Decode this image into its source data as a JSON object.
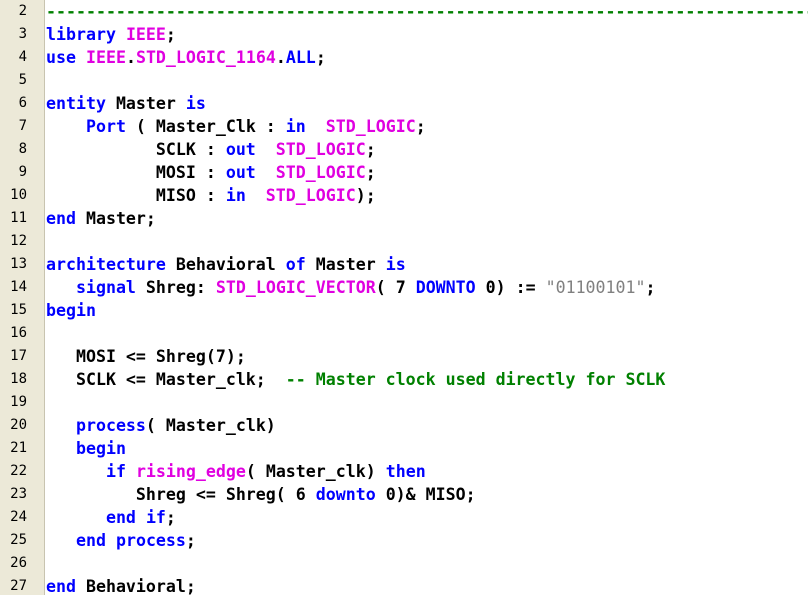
{
  "editor": {
    "colors": {
      "text": "#000000",
      "keyword": "#0000ff",
      "type": "#e000e0",
      "string": "#808080",
      "comment": "#008000",
      "gutter": "#ece9d8"
    },
    "lines": [
      {
        "number": "2",
        "tokens": [
          {
            "t": "comment",
            "v": "-----------------------------------------------------------------------------------"
          }
        ]
      },
      {
        "number": "3",
        "tokens": [
          {
            "t": "keyword",
            "v": "library"
          },
          {
            "t": "text",
            "v": " "
          },
          {
            "t": "type",
            "v": "IEEE"
          },
          {
            "t": "text",
            "v": ";"
          }
        ]
      },
      {
        "number": "4",
        "tokens": [
          {
            "t": "keyword",
            "v": "use"
          },
          {
            "t": "text",
            "v": " "
          },
          {
            "t": "type",
            "v": "IEEE"
          },
          {
            "t": "text",
            "v": "."
          },
          {
            "t": "type",
            "v": "STD_LOGIC_1164"
          },
          {
            "t": "text",
            "v": "."
          },
          {
            "t": "keyword",
            "v": "ALL"
          },
          {
            "t": "text",
            "v": ";"
          }
        ]
      },
      {
        "number": "5",
        "tokens": []
      },
      {
        "number": "6",
        "tokens": [
          {
            "t": "keyword",
            "v": "entity"
          },
          {
            "t": "text",
            "v": " Master "
          },
          {
            "t": "keyword",
            "v": "is"
          }
        ]
      },
      {
        "number": "7",
        "tokens": [
          {
            "t": "text",
            "v": "    "
          },
          {
            "t": "keyword",
            "v": "Port"
          },
          {
            "t": "text",
            "v": " ( Master_Clk : "
          },
          {
            "t": "keyword",
            "v": "in"
          },
          {
            "t": "text",
            "v": "  "
          },
          {
            "t": "type",
            "v": "STD_LOGIC"
          },
          {
            "t": "text",
            "v": ";"
          }
        ]
      },
      {
        "number": "8",
        "tokens": [
          {
            "t": "text",
            "v": "           SCLK : "
          },
          {
            "t": "keyword",
            "v": "out"
          },
          {
            "t": "text",
            "v": "  "
          },
          {
            "t": "type",
            "v": "STD_LOGIC"
          },
          {
            "t": "text",
            "v": ";"
          }
        ]
      },
      {
        "number": "9",
        "tokens": [
          {
            "t": "text",
            "v": "           MOSI : "
          },
          {
            "t": "keyword",
            "v": "out"
          },
          {
            "t": "text",
            "v": "  "
          },
          {
            "t": "type",
            "v": "STD_LOGIC"
          },
          {
            "t": "text",
            "v": ";"
          }
        ]
      },
      {
        "number": "10",
        "tokens": [
          {
            "t": "text",
            "v": "           MISO : "
          },
          {
            "t": "keyword",
            "v": "in"
          },
          {
            "t": "text",
            "v": "  "
          },
          {
            "t": "type",
            "v": "STD_LOGIC"
          },
          {
            "t": "text",
            "v": ");"
          }
        ]
      },
      {
        "number": "11",
        "tokens": [
          {
            "t": "keyword",
            "v": "end"
          },
          {
            "t": "text",
            "v": " Master;"
          }
        ]
      },
      {
        "number": "12",
        "tokens": []
      },
      {
        "number": "13",
        "tokens": [
          {
            "t": "keyword",
            "v": "architecture"
          },
          {
            "t": "text",
            "v": " Behavioral "
          },
          {
            "t": "keyword",
            "v": "of"
          },
          {
            "t": "text",
            "v": " Master "
          },
          {
            "t": "keyword",
            "v": "is"
          }
        ]
      },
      {
        "number": "14",
        "tokens": [
          {
            "t": "text",
            "v": "   "
          },
          {
            "t": "keyword",
            "v": "signal"
          },
          {
            "t": "text",
            "v": " Shreg: "
          },
          {
            "t": "type",
            "v": "STD_LOGIC_VECTOR"
          },
          {
            "t": "text",
            "v": "( 7 "
          },
          {
            "t": "keyword",
            "v": "DOWNTO"
          },
          {
            "t": "text",
            "v": " 0) := "
          },
          {
            "t": "string",
            "v": "\"01100101\""
          },
          {
            "t": "text",
            "v": ";"
          }
        ]
      },
      {
        "number": "15",
        "tokens": [
          {
            "t": "keyword",
            "v": "begin"
          }
        ]
      },
      {
        "number": "16",
        "tokens": []
      },
      {
        "number": "17",
        "tokens": [
          {
            "t": "text",
            "v": "   MOSI <= Shreg(7);"
          }
        ]
      },
      {
        "number": "18",
        "tokens": [
          {
            "t": "text",
            "v": "   SCLK <= Master_clk;  "
          },
          {
            "t": "comment",
            "v": "-- Master clock used directly for SCLK"
          }
        ]
      },
      {
        "number": "19",
        "tokens": []
      },
      {
        "number": "20",
        "tokens": [
          {
            "t": "text",
            "v": "   "
          },
          {
            "t": "keyword",
            "v": "process"
          },
          {
            "t": "text",
            "v": "( Master_clk)"
          }
        ]
      },
      {
        "number": "21",
        "tokens": [
          {
            "t": "text",
            "v": "   "
          },
          {
            "t": "keyword",
            "v": "begin"
          }
        ]
      },
      {
        "number": "22",
        "tokens": [
          {
            "t": "text",
            "v": "      "
          },
          {
            "t": "keyword",
            "v": "if"
          },
          {
            "t": "text",
            "v": " "
          },
          {
            "t": "type",
            "v": "rising_edge"
          },
          {
            "t": "text",
            "v": "( Master_clk) "
          },
          {
            "t": "keyword",
            "v": "then"
          }
        ]
      },
      {
        "number": "23",
        "tokens": [
          {
            "t": "text",
            "v": "         Shreg <= Shreg( 6 "
          },
          {
            "t": "keyword",
            "v": "downto"
          },
          {
            "t": "text",
            "v": " 0)& MISO;"
          }
        ]
      },
      {
        "number": "24",
        "tokens": [
          {
            "t": "text",
            "v": "      "
          },
          {
            "t": "keyword",
            "v": "end"
          },
          {
            "t": "text",
            "v": " "
          },
          {
            "t": "keyword",
            "v": "if"
          },
          {
            "t": "text",
            "v": ";"
          }
        ]
      },
      {
        "number": "25",
        "tokens": [
          {
            "t": "text",
            "v": "   "
          },
          {
            "t": "keyword",
            "v": "end"
          },
          {
            "t": "text",
            "v": " "
          },
          {
            "t": "keyword",
            "v": "process"
          },
          {
            "t": "text",
            "v": ";"
          }
        ]
      },
      {
        "number": "26",
        "tokens": []
      },
      {
        "number": "27",
        "tokens": [
          {
            "t": "keyword",
            "v": "end"
          },
          {
            "t": "text",
            "v": " Behavioral;"
          }
        ]
      }
    ]
  }
}
